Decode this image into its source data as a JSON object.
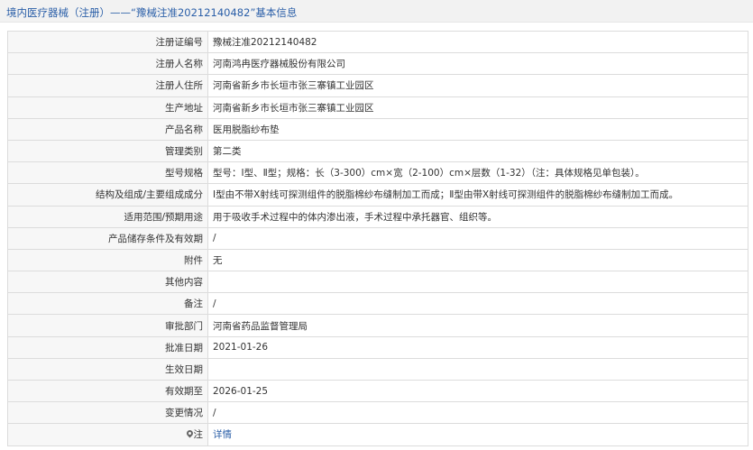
{
  "header": {
    "title": "境内医疗器械（注册）——“豫械注准20212140482”基本信息"
  },
  "rows": [
    {
      "label": "注册证编号",
      "value": "豫械注准20212140482"
    },
    {
      "label": "注册人名称",
      "value": "河南鸿冉医疗器械股份有限公司"
    },
    {
      "label": "注册人住所",
      "value": "河南省新乡市长垣市张三寨镇工业园区"
    },
    {
      "label": "生产地址",
      "value": "河南省新乡市长垣市张三寨镇工业园区"
    },
    {
      "label": "产品名称",
      "value": "医用脱脂纱布垫"
    },
    {
      "label": "管理类别",
      "value": "第二类"
    },
    {
      "label": "型号规格",
      "value": "型号：Ⅰ型、Ⅱ型；规格：长（3-300）cm×宽（2-100）cm×层数（1-32）（注：具体规格见单包装）。"
    },
    {
      "label": "结构及组成/主要组成成分",
      "value": "Ⅰ型由不带X射线可探测组件的脱脂棉纱布缝制加工而成；Ⅱ型由带X射线可探测组件的脱脂棉纱布缝制加工而成。"
    },
    {
      "label": "适用范围/预期用途",
      "value": "用于吸收手术过程中的体内渗出液，手术过程中承托器官、组织等。"
    },
    {
      "label": "产品储存条件及有效期",
      "value": "/"
    },
    {
      "label": "附件",
      "value": "无"
    },
    {
      "label": "其他内容",
      "value": ""
    },
    {
      "label": "备注",
      "value": "/"
    },
    {
      "label": "审批部门",
      "value": "河南省药品监督管理局"
    },
    {
      "label": "批准日期",
      "value": "2021-01-26"
    },
    {
      "label": "生效日期",
      "value": ""
    },
    {
      "label": "有效期至",
      "value": "2026-01-25"
    },
    {
      "label": "变更情况",
      "value": "/"
    }
  ],
  "last_row": {
    "label": "注",
    "label_icon": "location-pin-icon",
    "link_text": "详情"
  },
  "colors": {
    "link": "#2b5fa8",
    "label_bg": "#f7f7f7",
    "border": "#dcdcdc",
    "header_bg": "#f2f2f2"
  }
}
